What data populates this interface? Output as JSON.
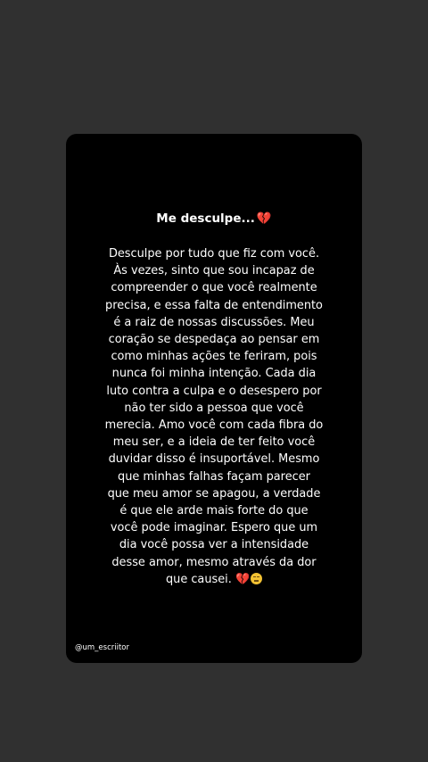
{
  "post": {
    "title": "Me desculpe...",
    "lines": [
      "Desculpe por tudo que fiz com você.",
      "Às vezes, sinto que sou incapaz de",
      "compreender o que você realmente",
      "precisa, e essa falta de entendimento",
      "é a raiz de nossas discussões. Meu",
      "coração se despedaça ao pensar em",
      "como minhas ações te feriram, pois",
      "nunca foi minha intenção. Cada dia",
      "luto contra a culpa e o desespero por",
      "não ter sido a pessoa que você",
      "merecia. Amo você com cada fibra do",
      "meu ser, e a ideia de ter feito você",
      "duvidar disso é insuportável. Mesmo",
      "que minhas falhas façam parecer",
      "que meu amor se apagou, a verdade",
      "é que ele arde mais forte do que",
      "você pode imaginar. Espero que um",
      "dia você possa ver a intensidade",
      "desse amor, mesmo através da dor",
      "que causei."
    ],
    "handle": "@um_escriitor"
  },
  "icons": {
    "title_emoji": "broken-heart-icon",
    "end_emoji_1": "broken-heart-icon",
    "end_emoji_2": "pensive-face-icon"
  },
  "colors": {
    "background": "#303030",
    "card": "#000000",
    "text": "#ffffff",
    "heart": "#e0334a"
  }
}
